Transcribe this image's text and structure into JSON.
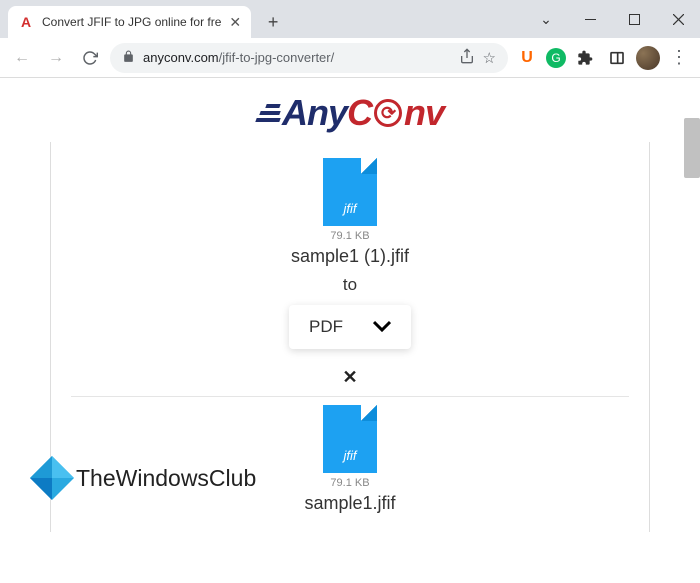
{
  "window": {
    "tab_title": "Convert JFIF to JPG online for fre",
    "favicon_letter": "A"
  },
  "toolbar": {
    "url_domain": "anyconv.com",
    "url_path": "/jfif-to-jpg-converter/"
  },
  "extensions": {
    "u_label": "U",
    "g_label": "G"
  },
  "logo": {
    "part1": "Any",
    "part2": "C",
    "part3": "nv"
  },
  "files": [
    {
      "ext_label": "jfif",
      "size": "79.1 KB",
      "name": "sample1 (1).jfif",
      "to_label": "to",
      "target_format": "PDF"
    },
    {
      "ext_label": "jfif",
      "size": "79.1 KB",
      "name": "sample1.jfif"
    }
  ],
  "watermark": {
    "text": "TheWindowsClub"
  }
}
